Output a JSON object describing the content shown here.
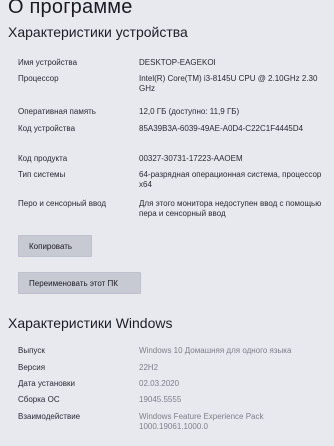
{
  "page_title": "О программе",
  "device_section": {
    "title": "Характеристики устройства",
    "rows": [
      {
        "label": "Имя устройства",
        "value": "DESKTOP-EAGEKOI"
      },
      {
        "label": "Процессор",
        "value": "Intel(R) Core(TM) i3-8145U CPU @ 2.10GHz 2.30 GHz"
      },
      {
        "label": "Оперативная память",
        "value": "12,0 ГБ (доступно: 11,9 ГБ)"
      },
      {
        "label": "Код устройства",
        "value": "85A39B3A-6039-49AE-A0D4-C22C1F4445D4"
      },
      {
        "label": "Код продукта",
        "value": "00327-30731-17223-AAOEM"
      },
      {
        "label": "Тип системы",
        "value": "64-разрядная операционная система, процессор x64"
      },
      {
        "label": "Перо и сенсорный ввод",
        "value": "Для этого монитора недоступен ввод с помощью пера и сенсорный ввод"
      }
    ],
    "copy_button_label": "Копировать",
    "rename_button_label": "Переименовать этот ПК"
  },
  "windows_section": {
    "title": "Характеристики Windows",
    "rows": [
      {
        "label": "Выпуск",
        "value": "Windows 10 Домашняя для одного языка"
      },
      {
        "label": "Версия",
        "value": "22H2"
      },
      {
        "label": "Дата установки",
        "value": "02.03.2020"
      },
      {
        "label": "Сборка ОС",
        "value": "19045.5555"
      },
      {
        "label": "Взаимодействие",
        "value": "Windows Feature Experience Pack 1000.19061.1000.0"
      }
    ]
  }
}
